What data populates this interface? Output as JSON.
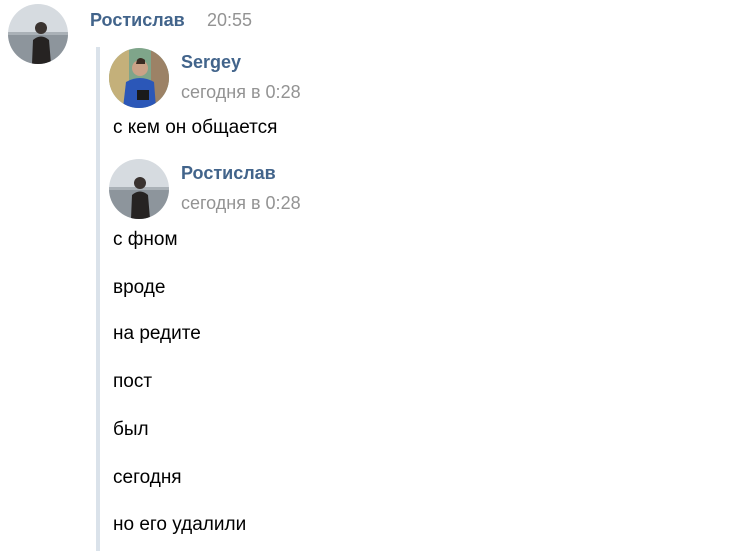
{
  "outer_message": {
    "author": "Ростислав",
    "time": "20:55",
    "avatar_icon": "user-avatar-rostislav"
  },
  "forwarded": [
    {
      "author": "Sergey",
      "time": "сегодня в 0:28",
      "avatar_icon": "user-avatar-sergey",
      "messages": [
        "с кем он общается"
      ]
    },
    {
      "author": "Ростислав",
      "time": "сегодня в 0:28",
      "avatar_icon": "user-avatar-rostislav",
      "messages": [
        "с фном",
        "вроде",
        "на редите",
        "пост",
        "был",
        "сегодня",
        "но его удалили"
      ]
    }
  ],
  "colors": {
    "author_name": "#42648b",
    "timestamp": "#939393",
    "forward_bar": "#dae2ea",
    "text": "#000000"
  }
}
